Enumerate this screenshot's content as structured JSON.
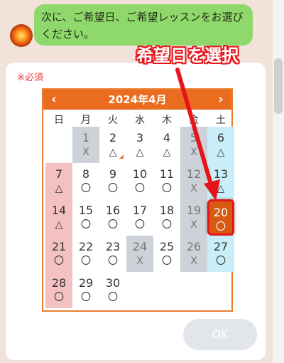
{
  "chat": {
    "message": "次に、ご希望日、ご希望レッスンをお選びください。"
  },
  "form": {
    "required_label": "※必須",
    "ok_label": "OK"
  },
  "calendar": {
    "title": "2024年4月",
    "prev_icon": "‹",
    "next_icon": "›",
    "weekdays": [
      "日",
      "月",
      "火",
      "水",
      "木",
      "金",
      "土"
    ],
    "days": [
      {
        "day": "1",
        "status": "X",
        "state": "closed"
      },
      {
        "day": "2",
        "status": "△",
        "state": "normal"
      },
      {
        "day": "3",
        "status": "△",
        "state": "normal"
      },
      {
        "day": "4",
        "status": "△",
        "state": "normal"
      },
      {
        "day": "5",
        "status": "X",
        "state": "closed"
      },
      {
        "day": "6",
        "status": "△",
        "state": "sat"
      },
      {
        "day": "7",
        "status": "△",
        "state": "sun"
      },
      {
        "day": "8",
        "status": "〇",
        "state": "normal"
      },
      {
        "day": "9",
        "status": "〇",
        "state": "normal"
      },
      {
        "day": "10",
        "status": "〇",
        "state": "normal"
      },
      {
        "day": "11",
        "status": "〇",
        "state": "normal"
      },
      {
        "day": "12",
        "status": "X",
        "state": "closed"
      },
      {
        "day": "13",
        "status": "△",
        "state": "sat"
      },
      {
        "day": "14",
        "status": "△",
        "state": "sun"
      },
      {
        "day": "15",
        "status": "〇",
        "state": "normal"
      },
      {
        "day": "16",
        "status": "〇",
        "state": "normal"
      },
      {
        "day": "17",
        "status": "〇",
        "state": "normal"
      },
      {
        "day": "18",
        "status": "〇",
        "state": "normal"
      },
      {
        "day": "19",
        "status": "X",
        "state": "closed"
      },
      {
        "day": "20",
        "status": "〇",
        "state": "selected"
      },
      {
        "day": "21",
        "status": "〇",
        "state": "sun"
      },
      {
        "day": "22",
        "status": "〇",
        "state": "normal"
      },
      {
        "day": "23",
        "status": "〇",
        "state": "normal"
      },
      {
        "day": "24",
        "status": "X",
        "state": "closed"
      },
      {
        "day": "25",
        "status": "〇",
        "state": "normal"
      },
      {
        "day": "26",
        "status": "X",
        "state": "closed"
      },
      {
        "day": "27",
        "status": "〇",
        "state": "sat"
      },
      {
        "day": "28",
        "status": "〇",
        "state": "sun"
      },
      {
        "day": "29",
        "status": "〇",
        "state": "normal"
      },
      {
        "day": "30",
        "status": "〇",
        "state": "normal"
      }
    ]
  },
  "annotation": {
    "text": "希望日を選択"
  },
  "colors": {
    "header": "#ea6d1f",
    "bubble": "#8fd86b",
    "annotation": "#e8141b",
    "selected": "#d65a0f"
  }
}
